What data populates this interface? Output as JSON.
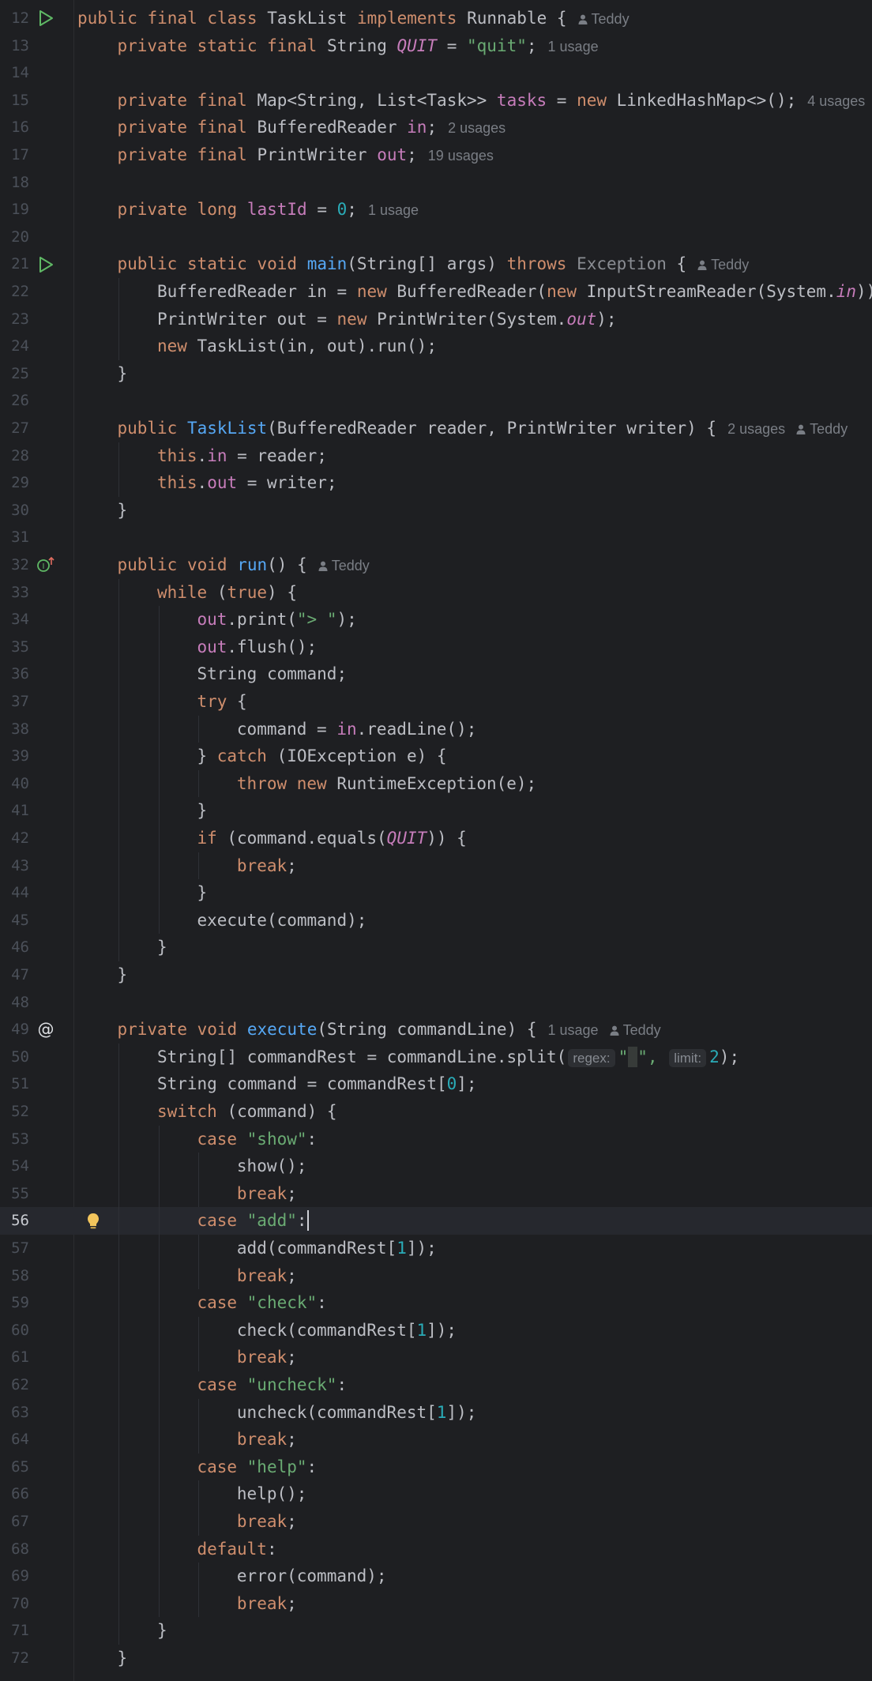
{
  "editor": {
    "colors": {
      "background": "#1e1f22",
      "keyword": "#cf8e6d",
      "string": "#6aab73",
      "number": "#2aacb8",
      "field": "#c77dbb",
      "method_declaration": "#56a8f5",
      "inlay_hint": "#7a7e85"
    },
    "gutter_icons": {
      "run": "run-icon",
      "implements": "implements-method-icon",
      "annotation": "at-sign-icon",
      "intention": "lightbulb-icon"
    },
    "current_line": 56,
    "lines": [
      {
        "n": "12",
        "gutter": "run",
        "indent": 0,
        "tokens": [
          {
            "t": "public final class ",
            "c": "k"
          },
          {
            "t": "TaskList "
          },
          {
            "t": "implements ",
            "c": "k"
          },
          {
            "t": "Runnable {"
          },
          {
            "t": "Teddy",
            "c": "author"
          }
        ]
      },
      {
        "n": "13",
        "indent": 1,
        "tokens": [
          {
            "t": "private static final ",
            "c": "k"
          },
          {
            "t": "String "
          },
          {
            "t": "QUIT",
            "c": "sti"
          },
          {
            "t": " = "
          },
          {
            "t": "\"quit\"",
            "c": "s"
          },
          {
            "t": ";"
          },
          {
            "t": "1 usage",
            "c": "hint"
          }
        ]
      },
      {
        "n": "14",
        "indent": 0,
        "tokens": []
      },
      {
        "n": "15",
        "indent": 1,
        "tokens": [
          {
            "t": "private final ",
            "c": "k"
          },
          {
            "t": "Map<String, List<Task>> "
          },
          {
            "t": "tasks",
            "c": "fld"
          },
          {
            "t": " = "
          },
          {
            "t": "new ",
            "c": "k"
          },
          {
            "t": "LinkedHashMap<>();"
          },
          {
            "t": "4 usages",
            "c": "hint"
          }
        ]
      },
      {
        "n": "16",
        "indent": 1,
        "tokens": [
          {
            "t": "private final ",
            "c": "k"
          },
          {
            "t": "BufferedReader "
          },
          {
            "t": "in",
            "c": "fld"
          },
          {
            "t": ";"
          },
          {
            "t": "2 usages",
            "c": "hint"
          }
        ]
      },
      {
        "n": "17",
        "indent": 1,
        "tokens": [
          {
            "t": "private final ",
            "c": "k"
          },
          {
            "t": "PrintWriter "
          },
          {
            "t": "out",
            "c": "fld"
          },
          {
            "t": ";"
          },
          {
            "t": "19 usages",
            "c": "hint"
          }
        ]
      },
      {
        "n": "18",
        "indent": 0,
        "tokens": []
      },
      {
        "n": "19",
        "indent": 1,
        "tokens": [
          {
            "t": "private long ",
            "c": "k"
          },
          {
            "t": "lastId",
            "c": "fld"
          },
          {
            "t": " = "
          },
          {
            "t": "0",
            "c": "n"
          },
          {
            "t": ";"
          },
          {
            "t": "1 usage",
            "c": "hint"
          }
        ]
      },
      {
        "n": "20",
        "indent": 0,
        "tokens": []
      },
      {
        "n": "21",
        "gutter": "run",
        "indent": 1,
        "tokens": [
          {
            "t": "public static void ",
            "c": "k"
          },
          {
            "t": "main",
            "c": "fn"
          },
          {
            "t": "(String[] args) "
          },
          {
            "t": "throws ",
            "c": "k"
          },
          {
            "t": "Exception",
            "c": "dim"
          },
          {
            "t": " {"
          },
          {
            "t": "Teddy",
            "c": "author"
          }
        ]
      },
      {
        "n": "22",
        "indent": 2,
        "tokens": [
          {
            "t": "BufferedReader in = "
          },
          {
            "t": "new ",
            "c": "k"
          },
          {
            "t": "BufferedReader("
          },
          {
            "t": "new ",
            "c": "k"
          },
          {
            "t": "InputStreamReader(System."
          },
          {
            "t": "in",
            "c": "sti"
          },
          {
            "t": "));"
          }
        ]
      },
      {
        "n": "23",
        "indent": 2,
        "tokens": [
          {
            "t": "PrintWriter out = "
          },
          {
            "t": "new ",
            "c": "k"
          },
          {
            "t": "PrintWriter(System."
          },
          {
            "t": "out",
            "c": "sti"
          },
          {
            "t": ");"
          }
        ]
      },
      {
        "n": "24",
        "indent": 2,
        "tokens": [
          {
            "t": "new ",
            "c": "k"
          },
          {
            "t": "TaskList(in, out).run();"
          }
        ]
      },
      {
        "n": "25",
        "indent": 1,
        "tokens": [
          {
            "t": "}"
          }
        ]
      },
      {
        "n": "26",
        "indent": 0,
        "tokens": []
      },
      {
        "n": "27",
        "indent": 1,
        "tokens": [
          {
            "t": "public ",
            "c": "k"
          },
          {
            "t": "TaskList",
            "c": "fn"
          },
          {
            "t": "(BufferedReader reader, PrintWriter writer) {"
          },
          {
            "t": "2 usages",
            "c": "hint"
          },
          {
            "t": "Teddy",
            "c": "author"
          }
        ]
      },
      {
        "n": "28",
        "indent": 2,
        "tokens": [
          {
            "t": "this",
            "c": "k"
          },
          {
            "t": "."
          },
          {
            "t": "in",
            "c": "fld"
          },
          {
            "t": " = reader;"
          }
        ]
      },
      {
        "n": "29",
        "indent": 2,
        "tokens": [
          {
            "t": "this",
            "c": "k"
          },
          {
            "t": "."
          },
          {
            "t": "out",
            "c": "fld"
          },
          {
            "t": " = writer;"
          }
        ]
      },
      {
        "n": "30",
        "indent": 1,
        "tokens": [
          {
            "t": "}"
          }
        ]
      },
      {
        "n": "31",
        "indent": 0,
        "tokens": []
      },
      {
        "n": "32",
        "gutter": "implements",
        "indent": 1,
        "tokens": [
          {
            "t": "public void ",
            "c": "k"
          },
          {
            "t": "run",
            "c": "fn"
          },
          {
            "t": "() {"
          },
          {
            "t": "Teddy",
            "c": "author"
          }
        ]
      },
      {
        "n": "33",
        "indent": 2,
        "tokens": [
          {
            "t": "while ",
            "c": "k"
          },
          {
            "t": "("
          },
          {
            "t": "true",
            "c": "k"
          },
          {
            "t": ") {"
          }
        ]
      },
      {
        "n": "34",
        "indent": 3,
        "tokens": [
          {
            "t": "out",
            "c": "fld"
          },
          {
            "t": ".print("
          },
          {
            "t": "\"> \"",
            "c": "s"
          },
          {
            "t": ");"
          }
        ]
      },
      {
        "n": "35",
        "indent": 3,
        "tokens": [
          {
            "t": "out",
            "c": "fld"
          },
          {
            "t": ".flush();"
          }
        ]
      },
      {
        "n": "36",
        "indent": 3,
        "tokens": [
          {
            "t": "String command;"
          }
        ]
      },
      {
        "n": "37",
        "indent": 3,
        "tokens": [
          {
            "t": "try ",
            "c": "k"
          },
          {
            "t": "{"
          }
        ]
      },
      {
        "n": "38",
        "indent": 4,
        "tokens": [
          {
            "t": "command = "
          },
          {
            "t": "in",
            "c": "fld"
          },
          {
            "t": ".readLine();"
          }
        ]
      },
      {
        "n": "39",
        "indent": 3,
        "tokens": [
          {
            "t": "} "
          },
          {
            "t": "catch ",
            "c": "k"
          },
          {
            "t": "(IOException e) {"
          }
        ]
      },
      {
        "n": "40",
        "indent": 4,
        "tokens": [
          {
            "t": "throw new ",
            "c": "k"
          },
          {
            "t": "RuntimeException(e);"
          }
        ]
      },
      {
        "n": "41",
        "indent": 3,
        "tokens": [
          {
            "t": "}"
          }
        ]
      },
      {
        "n": "42",
        "indent": 3,
        "tokens": [
          {
            "t": "if ",
            "c": "k"
          },
          {
            "t": "(command.equals("
          },
          {
            "t": "QUIT",
            "c": "sti"
          },
          {
            "t": ")) {"
          }
        ]
      },
      {
        "n": "43",
        "indent": 4,
        "tokens": [
          {
            "t": "break",
            "c": "k"
          },
          {
            "t": ";"
          }
        ]
      },
      {
        "n": "44",
        "indent": 3,
        "tokens": [
          {
            "t": "}"
          }
        ]
      },
      {
        "n": "45",
        "indent": 3,
        "tokens": [
          {
            "t": "execute(command);"
          }
        ]
      },
      {
        "n": "46",
        "indent": 2,
        "tokens": [
          {
            "t": "}"
          }
        ]
      },
      {
        "n": "47",
        "indent": 1,
        "tokens": [
          {
            "t": "}"
          }
        ]
      },
      {
        "n": "48",
        "indent": 0,
        "tokens": []
      },
      {
        "n": "49",
        "gutter": "annotation",
        "indent": 1,
        "tokens": [
          {
            "t": "private void ",
            "c": "k"
          },
          {
            "t": "execute",
            "c": "fn"
          },
          {
            "t": "(String commandLine) {"
          },
          {
            "t": "1 usage",
            "c": "hint"
          },
          {
            "t": "Teddy",
            "c": "author"
          }
        ]
      },
      {
        "n": "50",
        "indent": 2,
        "tokens": [
          {
            "t": "String[] commandRest = commandLine.split("
          },
          {
            "t": "regex:",
            "c": "param"
          },
          {
            "t": "\"",
            "c": "s"
          },
          {
            "t": " ",
            "c": "spacehl"
          },
          {
            "t": "\",",
            "c": "s"
          },
          {
            "t": " "
          },
          {
            "t": "limit:",
            "c": "param"
          },
          {
            "t": "2",
            "c": "n"
          },
          {
            "t": ");"
          }
        ]
      },
      {
        "n": "51",
        "indent": 2,
        "tokens": [
          {
            "t": "String command = commandRest["
          },
          {
            "t": "0",
            "c": "n"
          },
          {
            "t": "];"
          }
        ]
      },
      {
        "n": "52",
        "indent": 2,
        "tokens": [
          {
            "t": "switch ",
            "c": "k"
          },
          {
            "t": "(command) {"
          }
        ]
      },
      {
        "n": "53",
        "indent": 3,
        "tokens": [
          {
            "t": "case ",
            "c": "k"
          },
          {
            "t": "\"show\"",
            "c": "s"
          },
          {
            "t": ":"
          }
        ]
      },
      {
        "n": "54",
        "indent": 4,
        "tokens": [
          {
            "t": "show();"
          }
        ]
      },
      {
        "n": "55",
        "indent": 4,
        "tokens": [
          {
            "t": "break",
            "c": "k"
          },
          {
            "t": ";"
          }
        ]
      },
      {
        "n": "56",
        "gutter": "intention",
        "current": true,
        "indent": 3,
        "tokens": [
          {
            "t": "case ",
            "c": "k"
          },
          {
            "t": "\"add\"",
            "c": "s"
          },
          {
            "t": ":"
          },
          {
            "t": "",
            "c": "caret"
          }
        ]
      },
      {
        "n": "57",
        "indent": 4,
        "tokens": [
          {
            "t": "add(commandRest["
          },
          {
            "t": "1",
            "c": "n"
          },
          {
            "t": "]);"
          }
        ]
      },
      {
        "n": "58",
        "indent": 4,
        "tokens": [
          {
            "t": "break",
            "c": "k"
          },
          {
            "t": ";"
          }
        ]
      },
      {
        "n": "59",
        "indent": 3,
        "tokens": [
          {
            "t": "case ",
            "c": "k"
          },
          {
            "t": "\"check\"",
            "c": "s"
          },
          {
            "t": ":"
          }
        ]
      },
      {
        "n": "60",
        "indent": 4,
        "tokens": [
          {
            "t": "check(commandRest["
          },
          {
            "t": "1",
            "c": "n"
          },
          {
            "t": "]);"
          }
        ]
      },
      {
        "n": "61",
        "indent": 4,
        "tokens": [
          {
            "t": "break",
            "c": "k"
          },
          {
            "t": ";"
          }
        ]
      },
      {
        "n": "62",
        "indent": 3,
        "tokens": [
          {
            "t": "case ",
            "c": "k"
          },
          {
            "t": "\"uncheck\"",
            "c": "s"
          },
          {
            "t": ":"
          }
        ]
      },
      {
        "n": "63",
        "indent": 4,
        "tokens": [
          {
            "t": "uncheck(commandRest["
          },
          {
            "t": "1",
            "c": "n"
          },
          {
            "t": "]);"
          }
        ]
      },
      {
        "n": "64",
        "indent": 4,
        "tokens": [
          {
            "t": "break",
            "c": "k"
          },
          {
            "t": ";"
          }
        ]
      },
      {
        "n": "65",
        "indent": 3,
        "tokens": [
          {
            "t": "case ",
            "c": "k"
          },
          {
            "t": "\"help\"",
            "c": "s"
          },
          {
            "t": ":"
          }
        ]
      },
      {
        "n": "66",
        "indent": 4,
        "tokens": [
          {
            "t": "help();"
          }
        ]
      },
      {
        "n": "67",
        "indent": 4,
        "tokens": [
          {
            "t": "break",
            "c": "k"
          },
          {
            "t": ";"
          }
        ]
      },
      {
        "n": "68",
        "indent": 3,
        "tokens": [
          {
            "t": "default",
            "c": "k"
          },
          {
            "t": ":"
          }
        ]
      },
      {
        "n": "69",
        "indent": 4,
        "tokens": [
          {
            "t": "error(command);"
          }
        ]
      },
      {
        "n": "70",
        "indent": 4,
        "tokens": [
          {
            "t": "break",
            "c": "k"
          },
          {
            "t": ";"
          }
        ]
      },
      {
        "n": "71",
        "indent": 2,
        "tokens": [
          {
            "t": "}"
          }
        ]
      },
      {
        "n": "72",
        "indent": 1,
        "tokens": [
          {
            "t": "}"
          }
        ]
      }
    ]
  }
}
